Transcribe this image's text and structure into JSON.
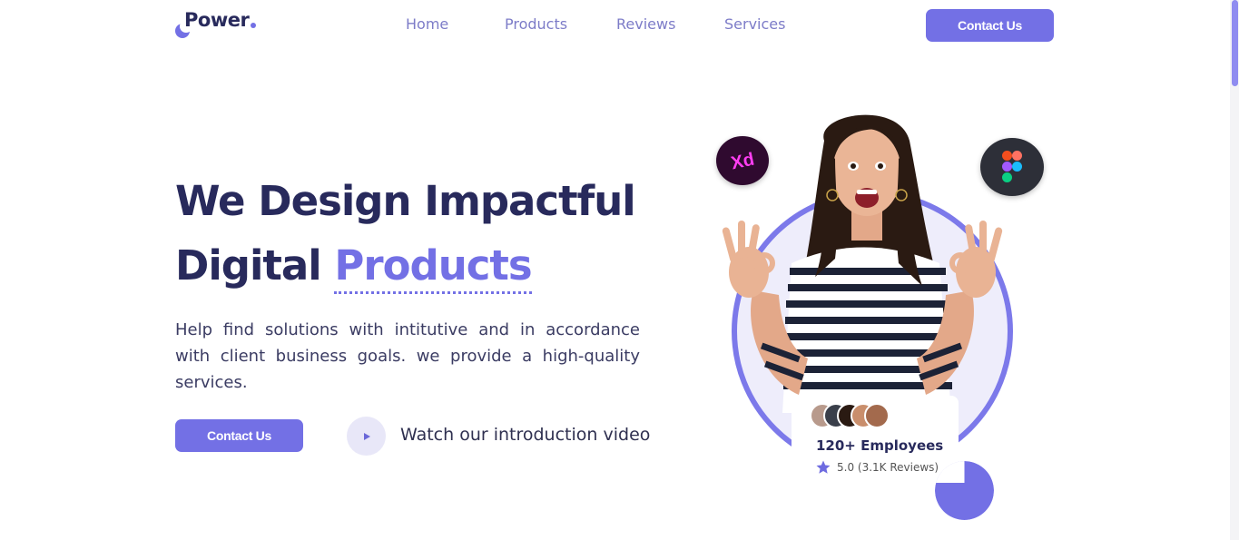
{
  "brand": {
    "name": "Power",
    "dot": ".",
    "accent": "#7370e5",
    "navy": "#282a5c"
  },
  "nav": {
    "links": [
      "Home",
      "Products",
      "Reviews",
      "Services"
    ],
    "cta": "Contact Us"
  },
  "hero": {
    "title_line1": "We Design Impactful",
    "title_line2_plain": "Digital",
    "title_line2_accent": "Products",
    "description": "Help find solutions with intitutive and in accordance with client business goals. we provide a high-quality services.",
    "cta": "Contact Us",
    "video_label": "Watch our introduction video"
  },
  "badges": {
    "xd": "Xd",
    "xd_icon": "adobe-xd-icon",
    "figma_icon": "figma-icon"
  },
  "stats": {
    "employees": "120+ Employees",
    "rating": "5.0 (3.1K Reviews)"
  }
}
